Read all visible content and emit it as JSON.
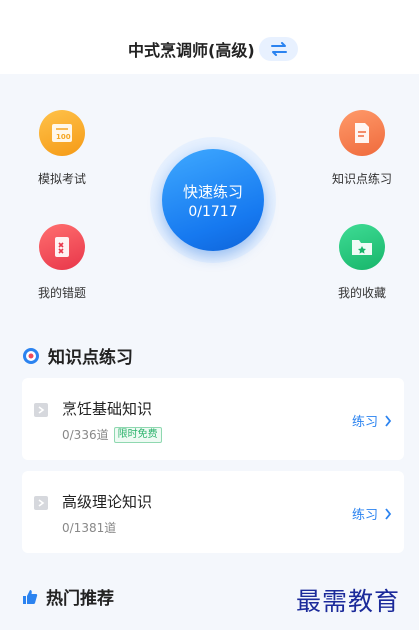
{
  "header": {
    "title": "中式烹调师(高级)"
  },
  "features": {
    "mock_exam": "模拟考试",
    "knowledge_practice": "知识点练习",
    "wrong_questions": "我的错题",
    "favorites": "我的收藏"
  },
  "quick_practice": {
    "label": "快速练习",
    "progress": "0/1717"
  },
  "knowledge_section": {
    "title": "知识点练习",
    "items": [
      {
        "title": "烹饪基础知识",
        "progress": "0/336道",
        "tag": "限时免费",
        "action": "练习"
      },
      {
        "title": "高级理论知识",
        "progress": "0/1381道",
        "action": "练习"
      }
    ]
  },
  "hot_section": {
    "title": "热门推荐"
  },
  "watermark": "最需教育",
  "colors": {
    "accent": "#2b83f0",
    "mock_exam": "#f5a623",
    "knowledge": "#f07a4a",
    "wrong": "#ef4b5b",
    "favorites": "#23c27a"
  }
}
